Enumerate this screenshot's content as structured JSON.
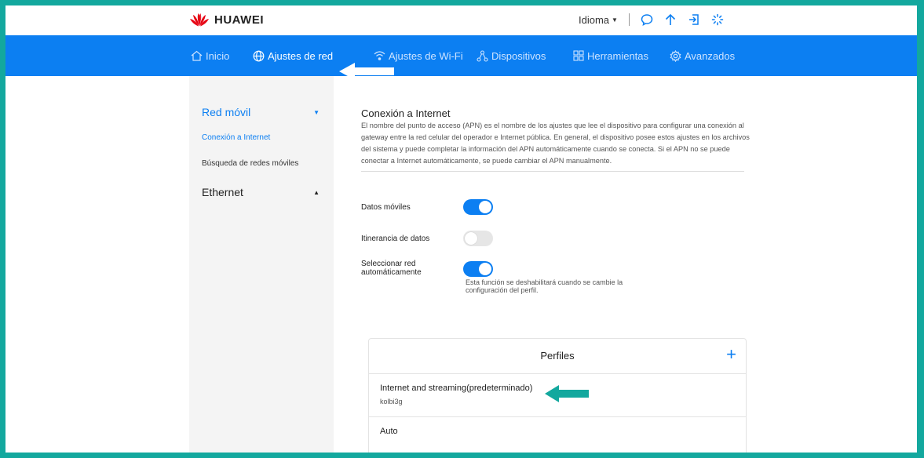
{
  "brand": {
    "name": "HUAWEI",
    "logo_color": "#e60012"
  },
  "topbar": {
    "language_label": "Idioma",
    "icons": [
      "chat-icon",
      "arrow-up-icon",
      "logout-icon",
      "loading-icon"
    ]
  },
  "nav": {
    "items": [
      {
        "label": "Inicio",
        "icon": "home-icon"
      },
      {
        "label": "Ajustes de red",
        "icon": "globe-icon",
        "active": true
      },
      {
        "label": "Ajustes de Wi-Fi",
        "icon": "wifi-icon"
      },
      {
        "label": "Dispositivos",
        "icon": "devices-icon"
      },
      {
        "label": "Herramientas",
        "icon": "tools-icon"
      },
      {
        "label": "Avanzados",
        "icon": "gear-icon"
      }
    ],
    "bg_color": "#0c7ff2"
  },
  "sidebar": {
    "groups": [
      {
        "label": "Red móvil",
        "expanded": true,
        "items": [
          "Conexión a Internet",
          "Búsqueda de redes móviles"
        ]
      },
      {
        "label": "Ethernet",
        "expanded": false
      }
    ]
  },
  "main": {
    "title": "Conexión a Internet",
    "description": "El nombre del punto de acceso (APN) es el nombre de los ajustes que lee el dispositivo para configurar una conexión al gateway entre la red celular del operador e Internet pública. En general, el dispositivo posee estos ajustes en los archivos del sistema y puede completar la información del APN automáticamente cuando se conecta. Si el APN no se puede conectar a Internet automáticamente, se puede cambiar el APN manualmente.",
    "settings": [
      {
        "label": "Datos móviles",
        "on": true
      },
      {
        "label": "Itinerancia de datos",
        "on": false
      },
      {
        "label": "Seleccionar red automáticamente",
        "on": true,
        "hint": "Esta función se deshabilitará cuando se cambie la configuración del perfil."
      }
    ],
    "profiles": {
      "title": "Perfiles",
      "items": [
        {
          "name": "Internet and streaming(predeterminado)",
          "apn": "kolbi3g"
        },
        {
          "name": "Auto"
        }
      ]
    }
  },
  "annotations": {
    "frame_color": "#13a89e"
  }
}
